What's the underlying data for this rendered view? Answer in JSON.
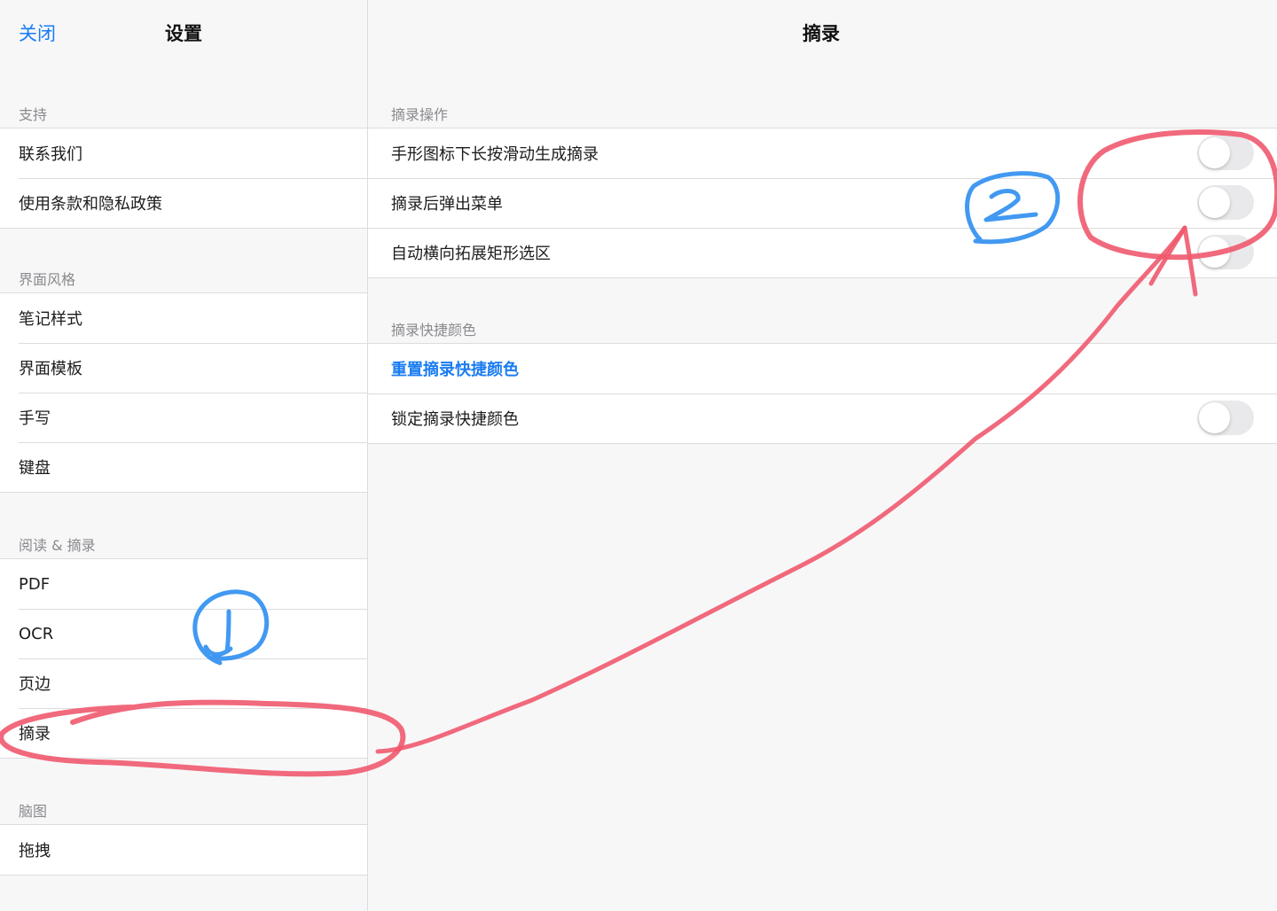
{
  "sidebar": {
    "close_label": "关闭",
    "title": "设置",
    "sections": [
      {
        "header": "支持",
        "items": [
          "联系我们",
          "使用条款和隐私政策"
        ]
      },
      {
        "header": "界面风格",
        "items": [
          "笔记样式",
          "界面模板",
          "手写",
          "键盘"
        ]
      },
      {
        "header": "阅读 & 摘录",
        "items": [
          "PDF",
          "OCR",
          "页边",
          "摘录"
        ]
      },
      {
        "header": "脑图",
        "items": [
          "拖拽"
        ]
      }
    ]
  },
  "detail": {
    "title": "摘录",
    "sections": [
      {
        "header": "摘录操作",
        "items": [
          {
            "label": "手形图标下长按滑动生成摘录",
            "toggle": false
          },
          {
            "label": "摘录后弹出菜单",
            "toggle": false
          },
          {
            "label": "自动横向拓展矩形选区",
            "toggle": false
          }
        ]
      },
      {
        "header": "摘录快捷颜色",
        "items": [
          {
            "label": "重置摘录快捷颜色"
          },
          {
            "label": "锁定摘录快捷颜色",
            "toggle": false
          }
        ]
      }
    ]
  },
  "annotations": {
    "red_color": "#f0596e",
    "blue_color": "#2d8ef0"
  }
}
